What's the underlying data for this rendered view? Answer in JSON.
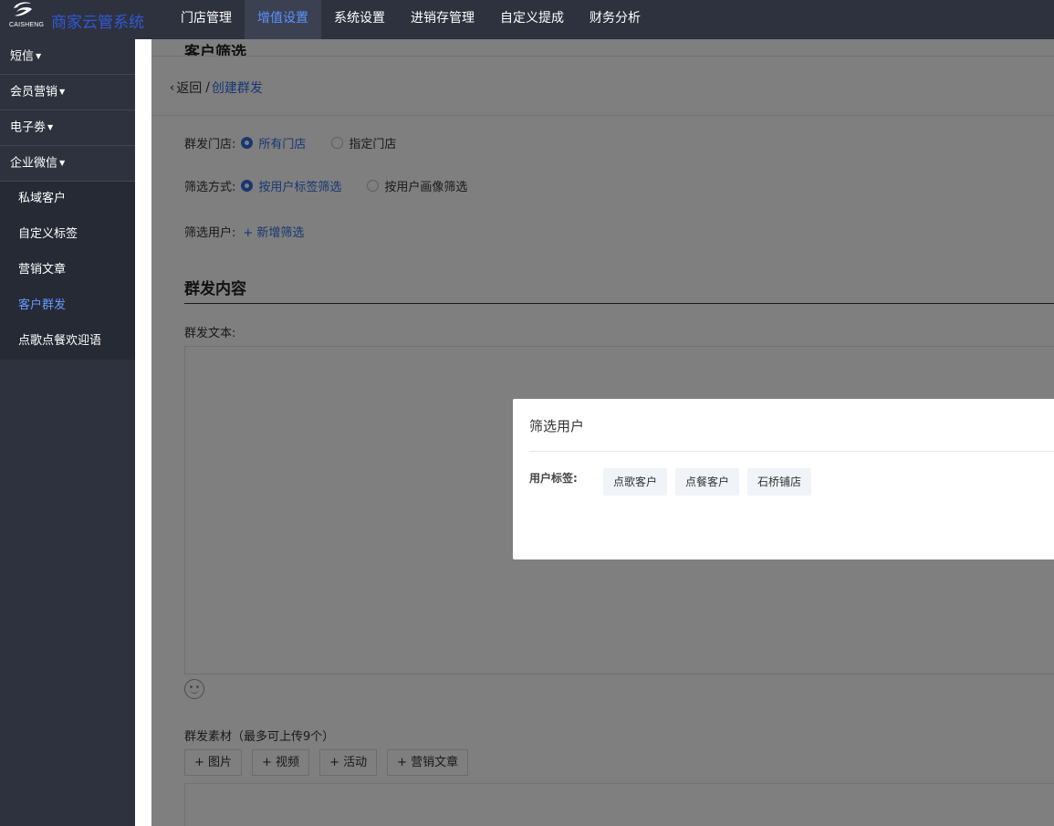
{
  "brand": {
    "logo_text": "CAISHENG",
    "name": "商家云管系统"
  },
  "nav": {
    "items": [
      {
        "label": "门店管理"
      },
      {
        "label": "增值设置"
      },
      {
        "label": "系统设置"
      },
      {
        "label": "进销存管理"
      },
      {
        "label": "自定义提成"
      },
      {
        "label": "财务分析"
      }
    ],
    "active_index": 1
  },
  "sidebar": {
    "groups": [
      "短信",
      "会员营销",
      "电子劵",
      "企业微信"
    ],
    "sub_items": [
      "私域客户",
      "自定义标签",
      "营销文章",
      "客户群发",
      "点歌点餐欢迎语"
    ],
    "active_sub": "客户群发"
  },
  "page": {
    "section_title": "客户筛选",
    "breadcrumb": {
      "back": "返回",
      "separator": "/",
      "current": "创建群发"
    },
    "store_row": {
      "label": "群发门店:",
      "options": [
        "所有门店",
        "指定门店"
      ]
    },
    "filter_row": {
      "label": "筛选方式:",
      "options": [
        "按用户标签筛选",
        "按用户画像筛选"
      ]
    },
    "user_row": {
      "label": "筛选用户:",
      "add_link": "+ 新增筛选"
    },
    "content_title": "群发内容",
    "text_label": "群发文本:",
    "material_label": "群发素材（最多可上传9个）",
    "material_buttons": [
      "+ 图片",
      "+ 视频",
      "+ 活动",
      "+ 营销文章"
    ]
  },
  "modal": {
    "title": "筛选用户",
    "tag_label": "用户标签:",
    "tags": [
      "点歌客户",
      "点餐客户",
      "石桥铺店"
    ]
  },
  "colors": {
    "nav_bg": "#2e323f",
    "accent": "#2f6fe4",
    "brand": "#2f59d4"
  }
}
